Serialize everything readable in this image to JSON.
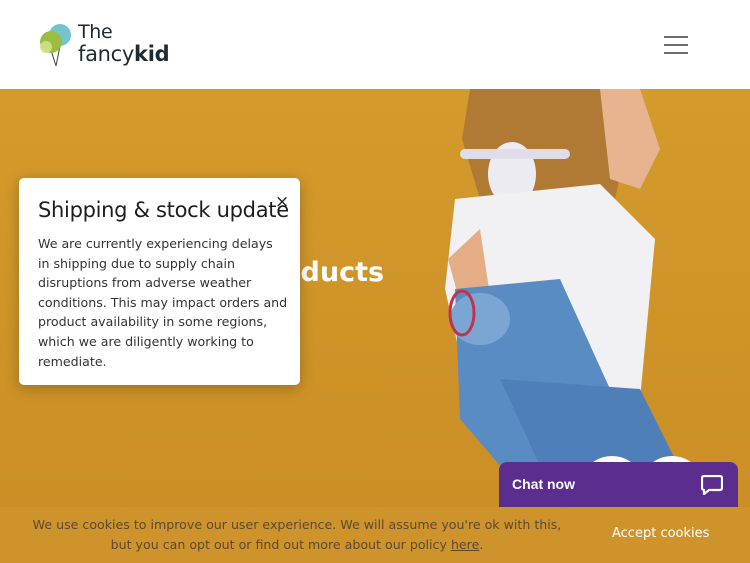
{
  "header": {
    "logo": {
      "line1": "The",
      "line2_light": "fancy",
      "line2_bold": "kid"
    },
    "menu_icon": "hamburger-menu-icon"
  },
  "hero": {
    "title_visible": "oducts"
  },
  "popup": {
    "title": "Shipping & stock update",
    "close_glyph": "×",
    "body": "We are currently experiencing delays in shipping due to supply chain disruptions from adverse weather conditions. This may impact orders and product availability in some regions, which we are diligently working to remediate."
  },
  "chat": {
    "label": "Chat now",
    "icon": "chat-bubble-icon",
    "color": "#5a2d8f"
  },
  "cookie_bar": {
    "text_before_link": "We use cookies to improve our user experience. We will assume you're ok with this, but you can opt out or find out more about our policy ",
    "link_text": "here",
    "text_after_link": ".",
    "accept_label": "Accept cookies"
  },
  "colors": {
    "hero_background": "#cf9428",
    "brand_purple": "#5a2d8f"
  }
}
